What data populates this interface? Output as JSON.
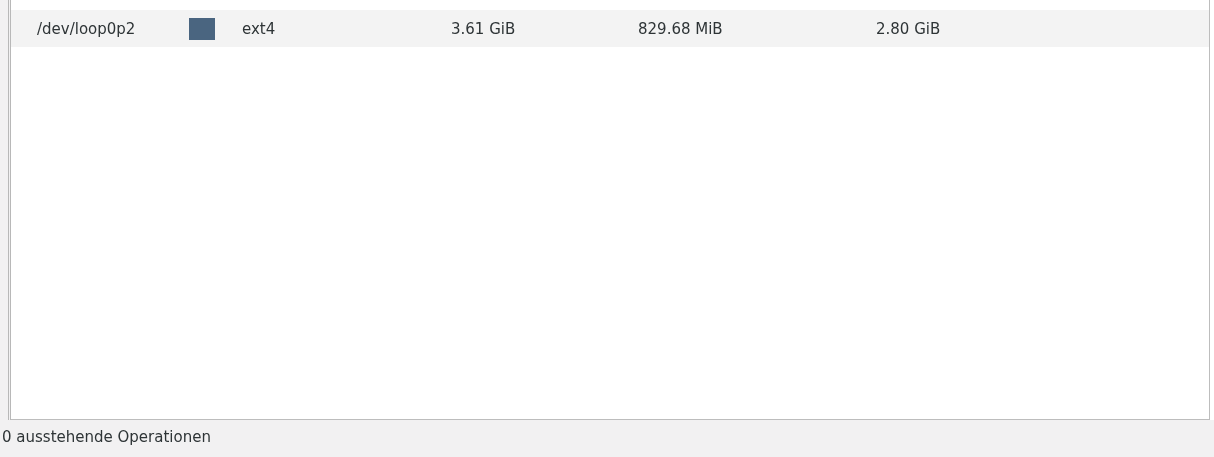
{
  "partitions": {
    "rows": [
      {
        "partition": "/dev/loop0p2",
        "color": "#4a6580",
        "filesystem": "ext4",
        "size": "3.61 GiB",
        "used": "829.68 MiB",
        "unused": "2.80 GiB",
        "selected": true
      }
    ]
  },
  "status_bar": {
    "text": "0 ausstehende Operationen"
  }
}
